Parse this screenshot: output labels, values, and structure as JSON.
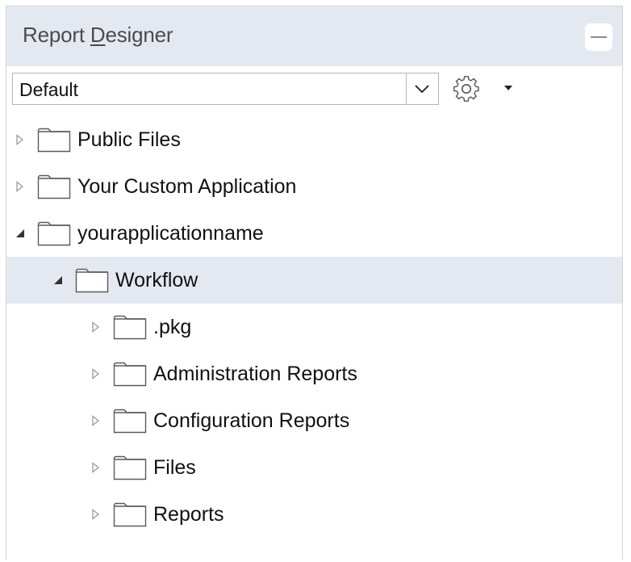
{
  "panel": {
    "title_before": "Report ",
    "title_mnemonic": "D",
    "title_after": "esigner",
    "collapse_icon": "minus-icon"
  },
  "toolbar": {
    "select_value": "Default",
    "select_icon": "chevron-down-icon",
    "settings_icon": "gear-icon",
    "settings_menu_icon": "caret-down-icon"
  },
  "tree": {
    "items": [
      {
        "label": "Public Files",
        "level": 0,
        "expanded": false
      },
      {
        "label": "Your Custom Application",
        "level": 0,
        "expanded": false
      },
      {
        "label": "yourapplicationname",
        "level": 0,
        "expanded": true
      },
      {
        "label": "Workflow",
        "level": 1,
        "expanded": true,
        "selected": true
      },
      {
        "label": ".pkg",
        "level": 2,
        "expanded": false
      },
      {
        "label": "Administration Reports",
        "level": 2,
        "expanded": false
      },
      {
        "label": "Configuration Reports",
        "level": 2,
        "expanded": false
      },
      {
        "label": "Files",
        "level": 2,
        "expanded": false
      },
      {
        "label": "Reports",
        "level": 2,
        "expanded": false
      }
    ]
  },
  "colors": {
    "header_bg": "#e4e9f1",
    "selected_row_bg": "#e4e9f1",
    "border": "#d3d3d3"
  }
}
